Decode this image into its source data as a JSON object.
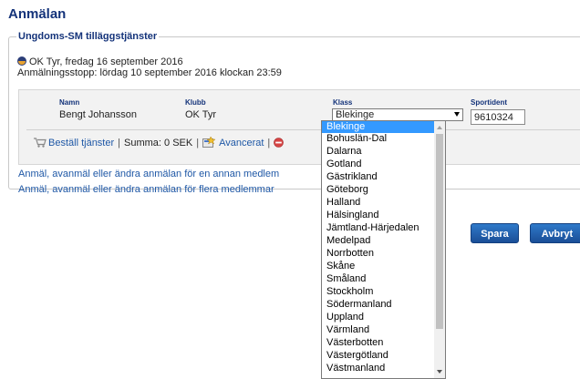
{
  "page": {
    "title": "Anmälan"
  },
  "section": {
    "legend": "Ungdoms-SM tilläggstjänster",
    "event": "OK Tyr, fredag 16 september 2016",
    "deadline": "Anmälningsstopp: lördag 10 september 2016 klockan 23:59"
  },
  "entry": {
    "headers": {
      "namn": "Namn",
      "klubb": "Klubb",
      "klass": "Klass",
      "sportident": "Sportident"
    },
    "name": "Bengt Johansson",
    "club": "OK Tyr",
    "selected_class": "Blekinge",
    "sportident_value": "9610324"
  },
  "actions": {
    "order_services": "Beställ tjänster",
    "sum": "Summa: 0 SEK",
    "advanced": "Avancerat"
  },
  "links": {
    "other_member": "Anmäl, avanmäl eller ändra anmälan för en annan medlem",
    "multiple_members": "Anmäl, avanmäl eller ändra anmälan för flera medlemmar"
  },
  "buttons": {
    "save": "Spara",
    "cancel": "Avbryt"
  },
  "dropdown": {
    "options": [
      "Blekinge",
      "Bohuslän-Dal",
      "Dalarna",
      "Gotland",
      "Gästrikland",
      "Göteborg",
      "Halland",
      "Hälsingland",
      "Jämtland-Härjedalen",
      "Medelpad",
      "Norrbotten",
      "Skåne",
      "Småland",
      "Stockholm",
      "Södermanland",
      "Uppland",
      "Värmland",
      "Västerbotten",
      "Västergötland",
      "Västmanland"
    ],
    "selected_index": 0
  },
  "colors": {
    "title": "#14337a",
    "link": "#1f58a6",
    "highlight": "#3399ff",
    "button": "#1f5fae"
  },
  "icons": [
    "event-flag-icon",
    "cart-icon",
    "advanced-settings-icon",
    "remove-icon",
    "chevron-down-icon"
  ]
}
